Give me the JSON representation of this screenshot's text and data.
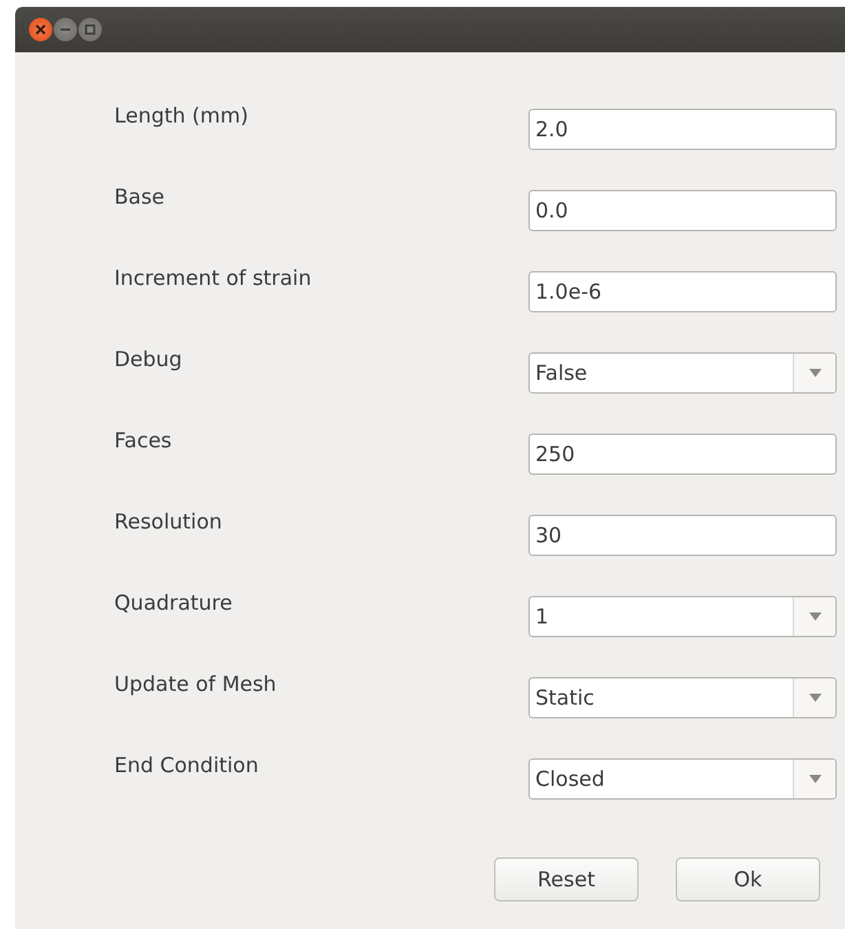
{
  "window": {
    "controls": [
      {
        "kind": "close"
      },
      {
        "kind": "minimize"
      },
      {
        "kind": "maximize"
      }
    ]
  },
  "fields": [
    {
      "label": "Length (mm)",
      "kind": "text",
      "value": "2.0"
    },
    {
      "label": "Base",
      "kind": "text",
      "value": "0.0"
    },
    {
      "label": "Increment of strain",
      "kind": "text",
      "value": "1.0e-6"
    },
    {
      "label": "Debug",
      "kind": "combo",
      "value": "False"
    },
    {
      "label": "Faces",
      "kind": "text",
      "value": "250"
    },
    {
      "label": "Resolution",
      "kind": "text",
      "value": "30"
    },
    {
      "label": "Quadrature",
      "kind": "combo",
      "value": "1"
    },
    {
      "label": "Update of Mesh",
      "kind": "combo",
      "value": "Static"
    },
    {
      "label": "End Condition",
      "kind": "combo",
      "value": "Closed"
    }
  ],
  "buttons": [
    "Reset",
    "Ok"
  ]
}
